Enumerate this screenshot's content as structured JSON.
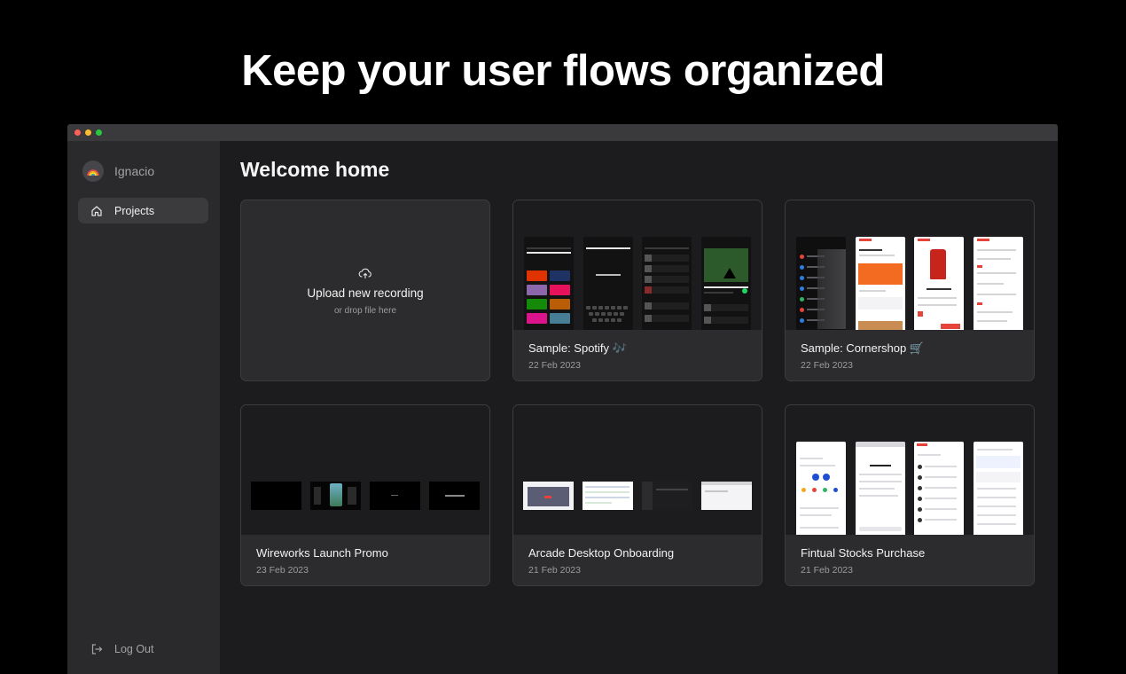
{
  "hero": {
    "title": "Keep your user flows organized"
  },
  "sidebar": {
    "user": {
      "name": "Ignacio",
      "avatar_icon": "rainbow-emoji"
    },
    "nav": [
      {
        "label": "Projects",
        "icon": "home-icon",
        "active": true
      }
    ],
    "logout": {
      "label": "Log Out",
      "icon": "logout-icon"
    }
  },
  "main": {
    "title": "Welcome home",
    "upload": {
      "title": "Upload new recording",
      "subtitle": "or drop file here",
      "icon": "upload-cloud-icon"
    },
    "projects": [
      {
        "title": "Sample: Spotify 🎶",
        "date": "22 Feb 2023"
      },
      {
        "title": "Sample: Cornershop 🛒",
        "date": "22 Feb 2023"
      },
      {
        "title": "Wireworks Launch Promo",
        "date": "23 Feb 2023"
      },
      {
        "title": "Arcade Desktop Onboarding",
        "date": "21 Feb 2023"
      },
      {
        "title": "Fintual Stocks Purchase",
        "date": "21 Feb 2023"
      }
    ]
  },
  "colors": {
    "background": "#000000",
    "window": "#1c1c1e",
    "sidebar": "#2a2a2c",
    "card": "#2c2c2e",
    "border": "#3d3d40"
  }
}
